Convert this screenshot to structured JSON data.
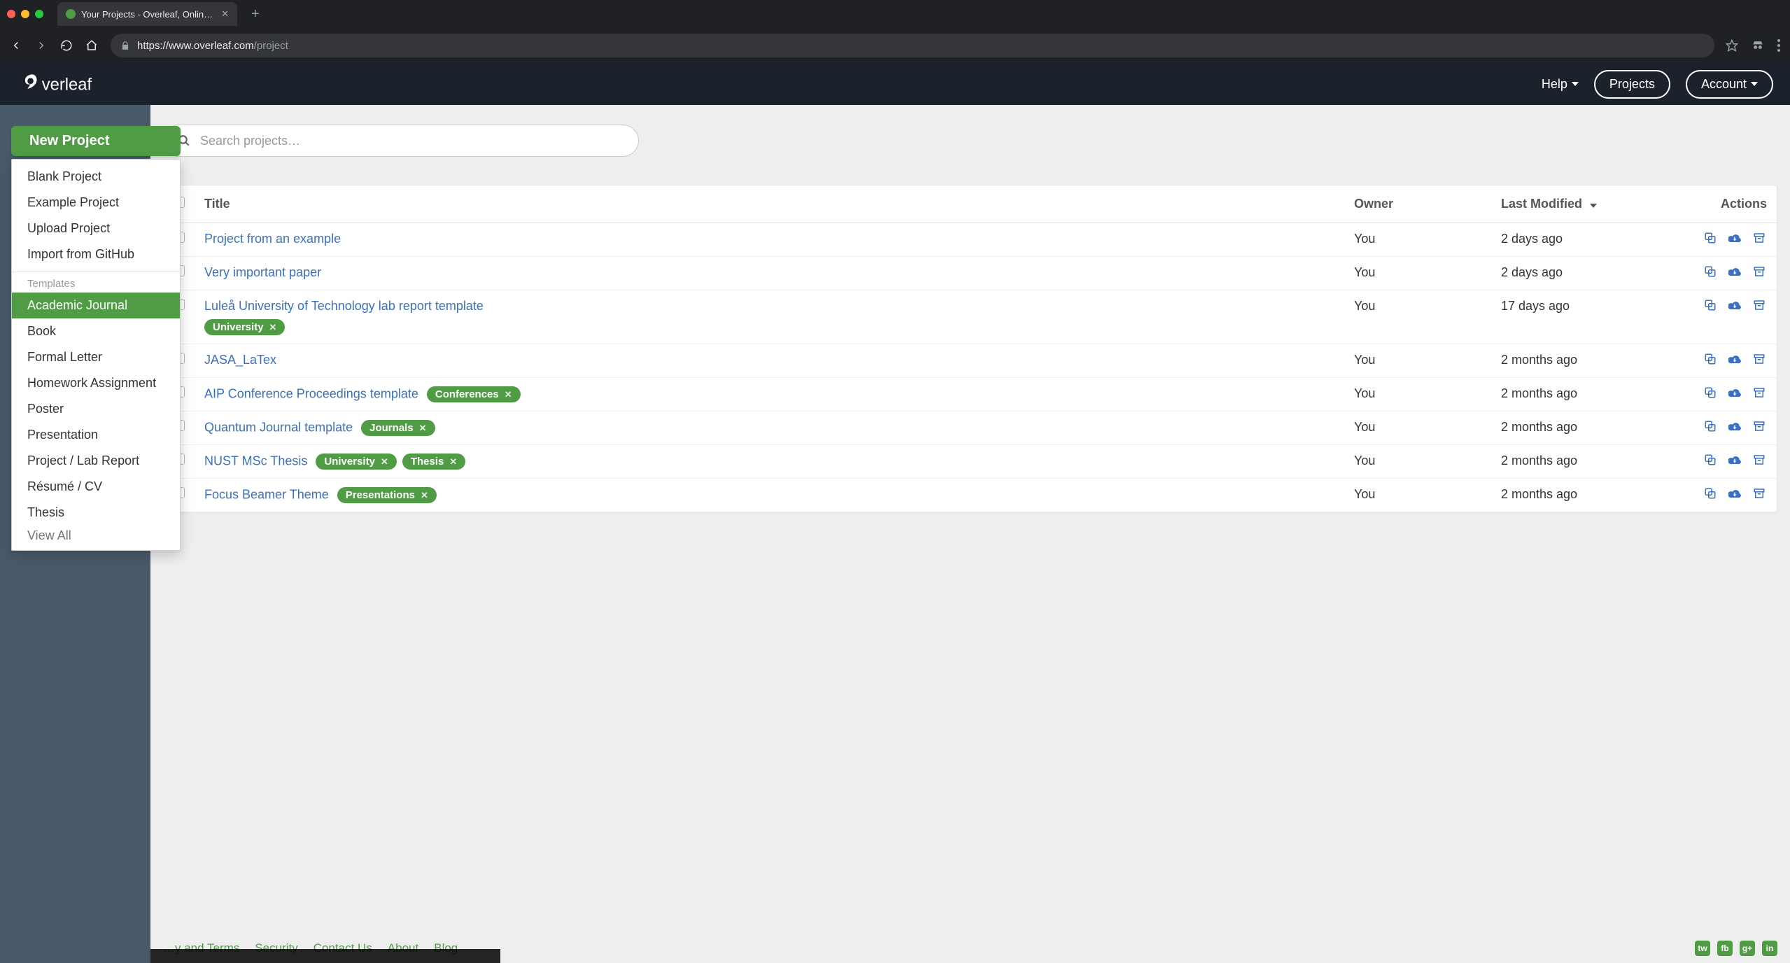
{
  "browser": {
    "tab_title": "Your Projects - Overleaf, Onlin…",
    "url_host": "https://www.overleaf.com",
    "url_path": "/project"
  },
  "header": {
    "help": "Help",
    "projects": "Projects",
    "account": "Account"
  },
  "new_project": {
    "button": "New Project",
    "items_top": [
      "Blank Project",
      "Example Project",
      "Upload Project",
      "Import from GitHub"
    ],
    "templates_header": "Templates",
    "templates": [
      "Academic Journal",
      "Book",
      "Formal Letter",
      "Homework Assignment",
      "Poster",
      "Presentation",
      "Project / Lab Report",
      "Résumé / CV",
      "Thesis",
      "View All"
    ],
    "active_template_index": 0
  },
  "search": {
    "placeholder": "Search projects…"
  },
  "table": {
    "columns": {
      "title": "Title",
      "owner": "Owner",
      "modified": "Last Modified",
      "actions": "Actions"
    },
    "rows": [
      {
        "title": "Project from an example",
        "owner": "You",
        "modified": "2 days ago",
        "tags": []
      },
      {
        "title": "Very important paper",
        "owner": "You",
        "modified": "2 days ago",
        "tags": []
      },
      {
        "title": "Luleå University of Technology lab report template",
        "owner": "You",
        "modified": "17 days ago",
        "tags": [
          "University"
        ],
        "tags_below": true
      },
      {
        "title": "JASA_LaTex",
        "owner": "You",
        "modified": "2 months ago",
        "tags": []
      },
      {
        "title": "AIP Conference Proceedings template",
        "owner": "You",
        "modified": "2 months ago",
        "tags": [
          "Conferences"
        ]
      },
      {
        "title": "Quantum Journal template",
        "owner": "You",
        "modified": "2 months ago",
        "tags": [
          "Journals"
        ]
      },
      {
        "title": "NUST MSc Thesis",
        "owner": "You",
        "modified": "2 months ago",
        "tags": [
          "University",
          "Thesis"
        ]
      },
      {
        "title": "Focus Beamer Theme",
        "owner": "You",
        "modified": "2 months ago",
        "tags": [
          "Presentations"
        ]
      }
    ]
  },
  "footer": {
    "links": [
      "…y and Terms",
      "Security",
      "Contact Us",
      "About",
      "Blog"
    ],
    "social": [
      "tw",
      "fb",
      "g+",
      "in"
    ]
  }
}
